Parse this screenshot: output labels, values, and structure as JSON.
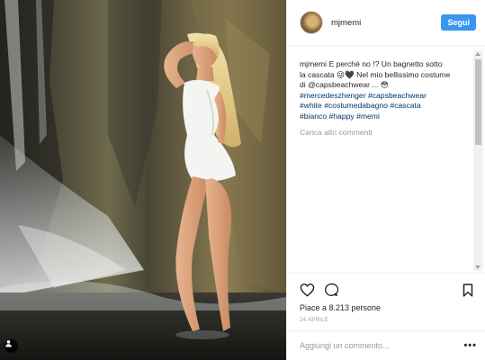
{
  "header": {
    "username": "mjmemi",
    "follow_label": "Segui"
  },
  "caption": {
    "username": "mjmemi",
    "lines": [
      "E perché no !? Un bagnetto sotto",
      "la cascata 😜🖤 Nel mio bellissimo costume",
      "di @capsbeachwear ... 😳"
    ],
    "hashtag_lines": [
      "#mercedeszhenger #capsbeachwear",
      "#white #costumedabagno #cascata",
      "#bianco #happy #memi"
    ],
    "load_more": "Carica altri commenti"
  },
  "actions": {
    "likes": "Piace a 8.213 persone",
    "date": "24 aprile"
  },
  "comment_box": {
    "placeholder": "Aggiungi un commento...",
    "more": "•••"
  },
  "icons": {
    "like": "heart-icon",
    "comment": "comment-icon",
    "save": "bookmark-icon",
    "user_tag": "person-icon"
  },
  "colors": {
    "follow_button": "#3897f0",
    "hashtag": "#003569",
    "muted": "#999999"
  }
}
